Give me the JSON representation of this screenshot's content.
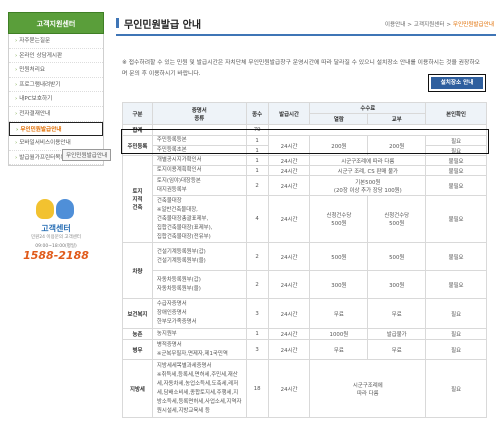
{
  "sidebar": {
    "header": "고객지원센터",
    "items": [
      "자주묻는질문",
      "온라인 상담게시판",
      "민원처리요",
      "프로그램내려받기",
      "내PC보호하기",
      "전자결재안내",
      "무인민원발급안내",
      "모바일서비스이용안내",
      "발급월가프린터목록"
    ],
    "tooltip": "무인민원발급안내",
    "callcenter": {
      "label": "고객센터",
      "sub": "민원24 이용문의 고객센터",
      "hours": "09:00~18:00(평일)",
      "number": "1588-2188"
    }
  },
  "header": {
    "title": "무인민원발급 안내",
    "breadcrumb": [
      "이용안내",
      "고객지원센터",
      "무인민원발급안내"
    ]
  },
  "notice": "※ 접수하려할 수 있는 민원 및 발급시간은 자치단체 무인민원발급창구 운영시간에 따라 달라질 수 있으니 설치장소 안내를 이용하시는 것을 권장하오며 문의 후 이용하시기 바랍니다.",
  "location_button": "설치장소 안내",
  "table": {
    "headers": {
      "category": "구분",
      "doc": "증명서\n종류",
      "count": "종수",
      "time": "발급시간",
      "fee": "수수료",
      "fee_print": "열람",
      "fee_copy": "교부",
      "id_check": "본인확인"
    },
    "total_label": "합계",
    "total_count": "79",
    "rows": [
      {
        "cat": "주민등록",
        "docs": [
          "주민등록등본",
          "주민등록초본"
        ],
        "count": "1",
        "count2": "1",
        "time": "24시간",
        "f1": "200원",
        "f2": "200원",
        "id": "필요",
        "id2": "필요"
      },
      {
        "cat": "토지\n지적\n건축",
        "docs": [
          "개별공시지가확인서"
        ],
        "count": "1",
        "time": "24시간",
        "f1": "시군구조례에 따라 다름",
        "id": "불필요"
      },
      {
        "docs": [
          "토지이용계획확인서"
        ],
        "count": "1",
        "time": "24시간",
        "f1": "시군구 조례, CS 판매 불가",
        "id": "불필요"
      },
      {
        "docs": [
          "토지(임야)대장등본",
          "대지권등록부"
        ],
        "count": "2",
        "time": "24시간",
        "f1": "기본500원",
        "f1b": "(20장 이상 추가 장당 100원)",
        "id": "불필요"
      },
      {
        "docs": [
          "건축물대장",
          "※일반건축물대장,",
          "건축물대장총괄표제부,",
          "집합건축물대장(표제부),",
          "집합건축물대장(전유부)"
        ],
        "count": "4",
        "time": "24시간",
        "f1": "신청건수당",
        "f1b": "500원",
        "f2": "신청건수당",
        "f2b": "500원",
        "id": "불필요"
      },
      {
        "cat": "차량",
        "docs": [
          "건설기계등록원부(갑)",
          "건설기계등록원부(을)"
        ],
        "count": "2",
        "time": "24시간",
        "f1": "500원",
        "f2": "500원",
        "id": "불필요"
      },
      {
        "docs": [
          "자동차등록원부(갑)",
          "자동차등록원부(을)"
        ],
        "count": "2",
        "time": "24시간",
        "f1": "300원",
        "f2": "300원",
        "id": "불필요"
      },
      {
        "cat": "보건복지",
        "docs": [
          "수급자증명서",
          "장애인증명서",
          "한부모가족증명서"
        ],
        "count": "3",
        "time": "24시간",
        "f1": "무료",
        "f2": "무료",
        "id": "필요"
      },
      {
        "cat": "농촌",
        "docs": [
          "농지원부"
        ],
        "count": "1",
        "time": "24시간",
        "f1": "1000원",
        "f2": "발급불가",
        "id": "필요"
      },
      {
        "cat": "병무",
        "docs": [
          "병적증명서",
          "※군복무필자,면제자,제1국민역"
        ],
        "count": "3",
        "time": "24시간",
        "f1": "무료",
        "f2": "무료",
        "id": "필요"
      },
      {
        "cat": "지방세",
        "docs": [
          "지방세세목별과세증명서",
          "※취득세,등록세,면허세,주민세,재산",
          "세,자동차세,농업소득세,도축세,레저",
          "세,담배소비세,종합토지세,주행세,지",
          "방소득세,등록면허세,사업소세,지역자",
          "원시설세,지방교육세 등"
        ],
        "count": "18",
        "time": "24시간",
        "f1": "시군구조례에",
        "f1b": "따라 다름",
        "id": "필요"
      }
    ]
  },
  "colors": {
    "brand_green": "#5a9e3a",
    "accent_blue": "#2f5f9e",
    "orange": "#e06d00"
  }
}
